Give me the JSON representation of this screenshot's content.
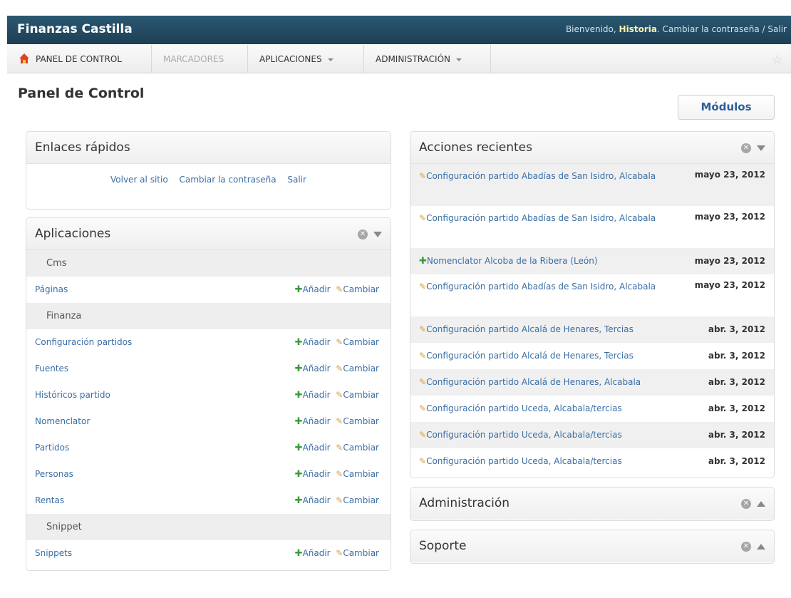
{
  "header": {
    "brand": "Finanzas Castilla",
    "welcome": "Bienvenido,",
    "user": "Historia",
    "change_password": "Cambiar la contraseña",
    "separator": "/",
    "logout": "Salir"
  },
  "nav": {
    "items": [
      {
        "label": "PANEL DE CONTROL"
      },
      {
        "label": "MARCADORES"
      },
      {
        "label": "APLICACIONES"
      },
      {
        "label": "ADMINISTRACIÓN"
      }
    ]
  },
  "page": {
    "title": "Panel de Control",
    "modules_button": "Módulos"
  },
  "quick_links": {
    "title": "Enlaces rápidos",
    "links": [
      "Volver al sitio",
      "Cambiar la contraseña",
      "Salir"
    ]
  },
  "apps": {
    "title": "Aplicaciones",
    "add_label": "Añadir",
    "change_label": "Cambiar",
    "groups": [
      {
        "name": "Cms",
        "models": [
          "Páginas"
        ]
      },
      {
        "name": "Finanza",
        "models": [
          "Configuración partidos",
          "Fuentes",
          "Históricos partido",
          "Nomenclator",
          "Partidos",
          "Personas",
          "Rentas"
        ]
      },
      {
        "name": "Snippet",
        "models": [
          "Snippets"
        ]
      }
    ]
  },
  "recent": {
    "title": "Acciones recientes",
    "items": [
      {
        "icon": "edit",
        "text": "Configuración partido Abadías de San Isidro, Alcabala",
        "date": "mayo 23, 2012"
      },
      {
        "icon": "edit",
        "text": "Configuración partido Abadías de San Isidro, Alcabala",
        "date": "mayo 23, 2012"
      },
      {
        "icon": "add",
        "text": "Nomenclator Alcoba de la Ribera (León)",
        "date": "mayo 23, 2012"
      },
      {
        "icon": "edit",
        "text": "Configuración partido Abadías de San Isidro, Alcabala",
        "date": "mayo 23, 2012"
      },
      {
        "icon": "edit",
        "text": "Configuración partido Alcalá de Henares, Tercias",
        "date": "abr. 3, 2012"
      },
      {
        "icon": "edit",
        "text": "Configuración partido Alcalá de Henares, Tercias",
        "date": "abr. 3, 2012"
      },
      {
        "icon": "edit",
        "text": "Configuración partido Alcalá de Henares, Alcabala",
        "date": "abr. 3, 2012"
      },
      {
        "icon": "edit",
        "text": "Configuración partido Uceda, Alcabala/tercias",
        "date": "abr. 3, 2012"
      },
      {
        "icon": "edit",
        "text": "Configuración partido Uceda, Alcabala/tercias",
        "date": "abr. 3, 2012"
      },
      {
        "icon": "edit",
        "text": "Configuración partido Uceda, Alcabala/tercias",
        "date": "abr. 3, 2012"
      }
    ]
  },
  "admin": {
    "title": "Administración"
  },
  "support": {
    "title": "Soporte"
  },
  "colors": {
    "header": "#1d3f54",
    "link": "#3a6ea5",
    "add": "#3b9a3b",
    "edit": "#d8a13a"
  }
}
